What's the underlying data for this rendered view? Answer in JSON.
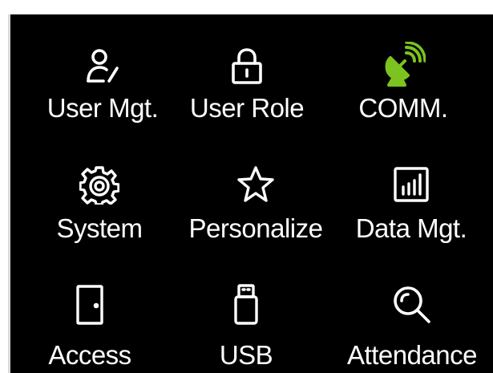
{
  "menu": {
    "items": [
      {
        "id": "user-mgt",
        "label": "User Mgt.",
        "icon": "user-edit-icon"
      },
      {
        "id": "user-role",
        "label": "User Role",
        "icon": "lock-icon"
      },
      {
        "id": "comm",
        "label": "COMM.",
        "icon": "satellite-dish-icon"
      },
      {
        "id": "system",
        "label": "System",
        "icon": "gear-icon"
      },
      {
        "id": "personalize",
        "label": "Personalize",
        "icon": "star-icon"
      },
      {
        "id": "data-mgt",
        "label": "Data Mgt.",
        "icon": "bar-chart-icon"
      },
      {
        "id": "access",
        "label": "Access",
        "icon": "door-icon"
      },
      {
        "id": "usb",
        "label": "USB",
        "icon": "usb-icon"
      },
      {
        "id": "attendance",
        "label": "Attendance",
        "icon": "search-icon"
      }
    ]
  },
  "colors": {
    "background": "#000000",
    "text": "#ffffff",
    "accent": "#7cc31f"
  }
}
